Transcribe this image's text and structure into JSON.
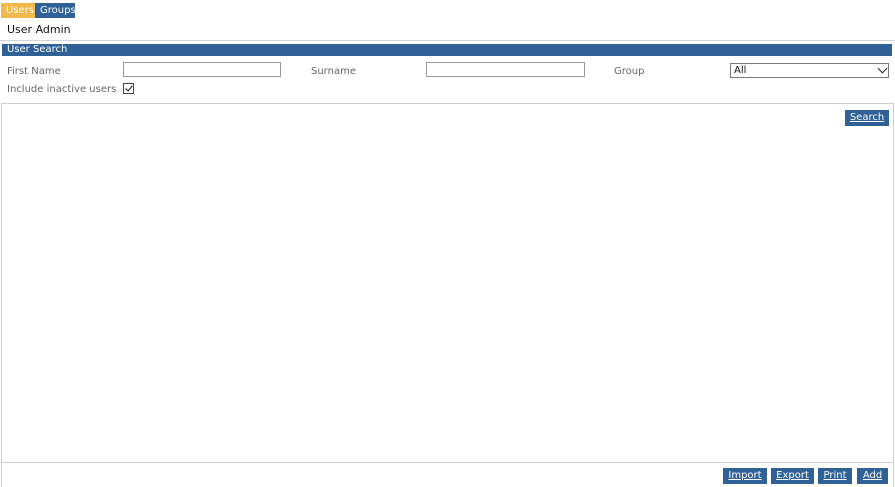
{
  "tabs": [
    {
      "label": "Users",
      "active": true
    },
    {
      "label": "Groups",
      "active": false
    }
  ],
  "page_title": "User Admin",
  "search_panel": {
    "header": "User Search",
    "first_name_label": "First Name",
    "first_name_value": "",
    "surname_label": "Surname",
    "surname_value": "",
    "group_label": "Group",
    "group_selected": "All",
    "include_inactive_label": "Include inactive users",
    "include_inactive_checked": true
  },
  "buttons": {
    "search": "Search",
    "import": "Import",
    "export": "Export",
    "print": "Print",
    "add": "Add"
  },
  "colors": {
    "accent_blue": "#2f6196",
    "active_tab": "#f0b94a"
  },
  "icons": {
    "dropdown": "chevron-down-icon",
    "checkbox": "check-icon"
  }
}
